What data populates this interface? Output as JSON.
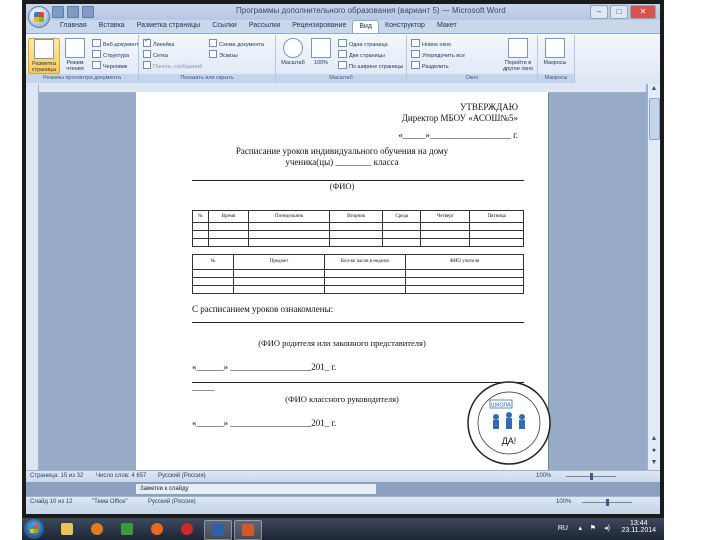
{
  "window": {
    "title": "Программы дополнительного образования (вариант 5) — Microsoft Word",
    "controls": [
      "–",
      "□",
      "✕"
    ]
  },
  "ribbon": {
    "tabs": [
      "Главная",
      "Вставка",
      "Разметка страницы",
      "Ссылки",
      "Рассылки",
      "Рецензирование",
      "Вид",
      "Конструктор",
      "Макет"
    ],
    "active_tab": "Вид",
    "groups": {
      "views": {
        "label": "Режимы просмотра документа",
        "big": [
          "Разметка страницы",
          "Режим чтения"
        ],
        "small": [
          "Веб-документ",
          "Структура",
          "Черновик"
        ]
      },
      "show": {
        "label": "Показать или скрыть",
        "items": [
          {
            "label": "Линейка",
            "checked": true
          },
          {
            "label": "Сетка",
            "checked": false
          },
          {
            "label": "Панель сообщений",
            "checked": false
          },
          {
            "label": "Схема документа",
            "checked": false
          },
          {
            "label": "Эскизы",
            "checked": false
          }
        ]
      },
      "zoom": {
        "label": "Масштаб",
        "big": [
          "Масштаб",
          "100%"
        ],
        "small": [
          "Одна страница",
          "Две страницы",
          "По ширине страницы"
        ]
      },
      "window": {
        "label": "Окно",
        "small": [
          "Новое окно",
          "Упорядочить все",
          "Разделить"
        ],
        "big": [
          "Перейти в другое окно"
        ]
      },
      "macros": {
        "label": "Макросы",
        "big": [
          "Макросы"
        ]
      }
    }
  },
  "document": {
    "approve": [
      "УТВЕРЖДАЮ",
      "Директор МБОУ «АСОШ№5»",
      "«_____»__________________ г."
    ],
    "schedule_title": [
      "Расписание уроков индивидуального обучения на дому",
      "ученика(цы) ________ класса"
    ],
    "fio": "(ФИО)",
    "table1_headers": [
      "№",
      "Время",
      "Понедельник",
      "Вторник",
      "Среда",
      "Четверг",
      "Пятница"
    ],
    "table1_rows": 3,
    "table2_headers": [
      "№",
      "Предмет",
      "Кол-во часов в неделю",
      "ФИО учителя"
    ],
    "table2_rows": 3,
    "acquainted": "С расписанием уроков ознакомлены:",
    "parent_caption": "(ФИО родителя или законного представителя)",
    "date_line_1": "«______» __________________201_ г.",
    "dash_short": "_____",
    "teacher_caption": "(ФИО классного руководителя)",
    "date_line_2": "«______» __________________201_ г.",
    "stamp": {
      "school": "ШКОЛА",
      "yes": "ДА!"
    }
  },
  "status_top": {
    "page": "Страница: 15 из 32",
    "words": "Число слов: 4 657",
    "lang": "Русский (Россия)",
    "zoom": "100%"
  },
  "behind_window": {
    "note": "Заметки к слайду"
  },
  "status_bottom": {
    "slide": "Слайд 10 из 12",
    "theme": "\"Тема Office\"",
    "lang": "Русский (Россия)",
    "zoom": "100%"
  },
  "taskbar": {
    "lang": "RU",
    "time": "13:44",
    "date": "23.11.2014"
  },
  "colors": {
    "ribbon": "#dbe6f4",
    "doc_background": "#98abc6",
    "taskbar": "#1c2533",
    "selected_button": "#f7c95c"
  }
}
